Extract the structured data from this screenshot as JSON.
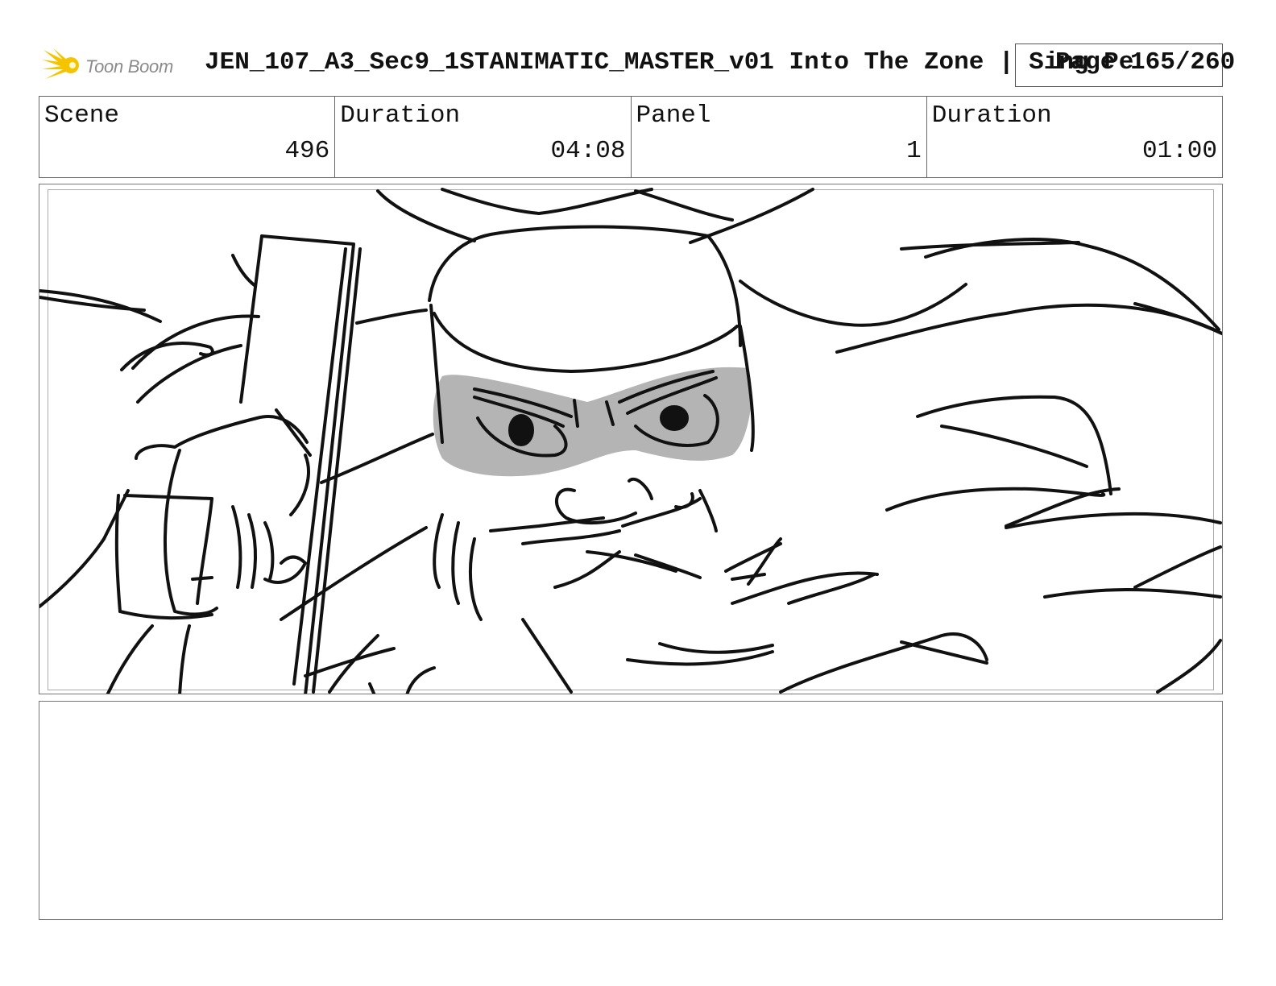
{
  "header": {
    "logo_text": "Toon Boom",
    "title": "JEN_107_A3_Sec9_1STANIMATIC_MASTER_v01  Into The Zone | Sing Pe",
    "page_label": "Page 165/260"
  },
  "info": {
    "scene_label": "Scene",
    "scene_value": "496",
    "scene_duration_label": "Duration",
    "scene_duration_value": "04:08",
    "panel_label": "Panel",
    "panel_value": "1",
    "panel_duration_label": "Duration",
    "panel_duration_value": "01:00"
  },
  "panel": {
    "image_description": "storyboard-sketch-bearded-warrior-with-headband-holding-sword"
  },
  "notes": {
    "text": ""
  },
  "colors": {
    "logo_yellow": "#f5c400",
    "sketch_line": "#111111",
    "eye_mask_gray": "#b4b4b4",
    "frame_border": "#777777"
  }
}
